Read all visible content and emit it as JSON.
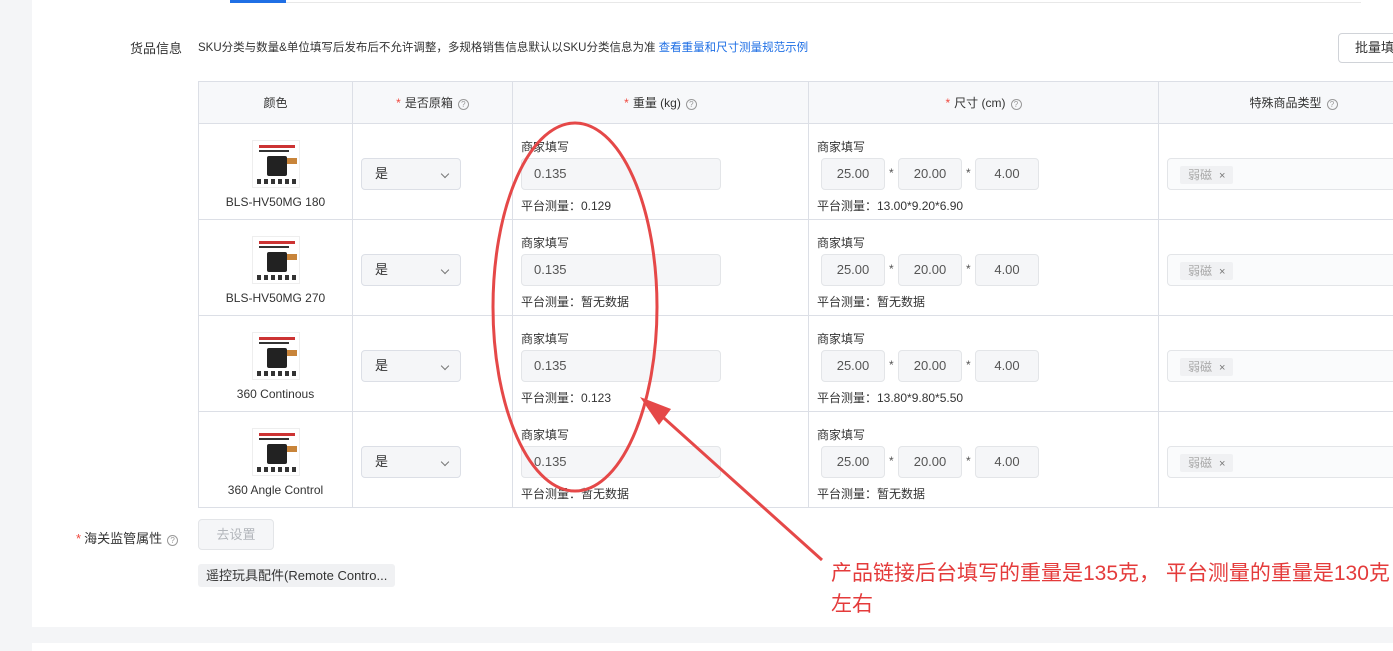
{
  "section": {
    "label": "货品信息",
    "hint_text": "SKU分类与数量&单位填写后发布后不允许调整，多规格销售信息默认以SKU分类信息为准",
    "hint_link": "查看重量和尺寸测量规范示例",
    "batch_button": "批量填"
  },
  "table": {
    "headers": {
      "color": "颜色",
      "original_box": "是否原箱",
      "weight": "重量 (kg)",
      "size": "尺寸 (cm)",
      "special_type": "特殊商品类型"
    },
    "required_mark": "*",
    "help_glyph": "?",
    "merchant_fill_label": "商家填写",
    "rows": [
      {
        "name": "BLS-HV50MG 180",
        "original_box": "是",
        "weight": "0.135",
        "weight_measured": "平台测量：0.129",
        "length": "25.00",
        "width": "20.00",
        "height": "4.00",
        "size_measured": "平台测量：13.00*9.20*6.90",
        "special_tag": "弱磁"
      },
      {
        "name": "BLS-HV50MG 270",
        "original_box": "是",
        "weight": "0.135",
        "weight_measured": "平台测量：暂无数据",
        "length": "25.00",
        "width": "20.00",
        "height": "4.00",
        "size_measured": "平台测量：暂无数据",
        "special_tag": "弱磁"
      },
      {
        "name": "360 Continous",
        "original_box": "是",
        "weight": "0.135",
        "weight_measured": "平台测量：0.123",
        "length": "25.00",
        "width": "20.00",
        "height": "4.00",
        "size_measured": "平台测量：13.80*9.80*5.50",
        "special_tag": "弱磁"
      },
      {
        "name": "360 Angle Control",
        "original_box": "是",
        "weight": "0.135",
        "weight_measured": "平台测量：暂无数据",
        "length": "25.00",
        "width": "20.00",
        "height": "4.00",
        "size_measured": "平台测量：暂无数据",
        "special_tag": "弱磁"
      }
    ],
    "dim_separator": "*",
    "tag_close": "×"
  },
  "customs": {
    "label": "海关监管属性",
    "button": "去设置",
    "category": "遥控玩具配件(Remote Contro..."
  },
  "annotation": {
    "text": "产品链接后台填写的重量是135克， 平台测量的重量是130克左右",
    "color": "#e43b3b"
  },
  "colors": {
    "accent": "#1f6fe5",
    "required": "#f0483e"
  }
}
